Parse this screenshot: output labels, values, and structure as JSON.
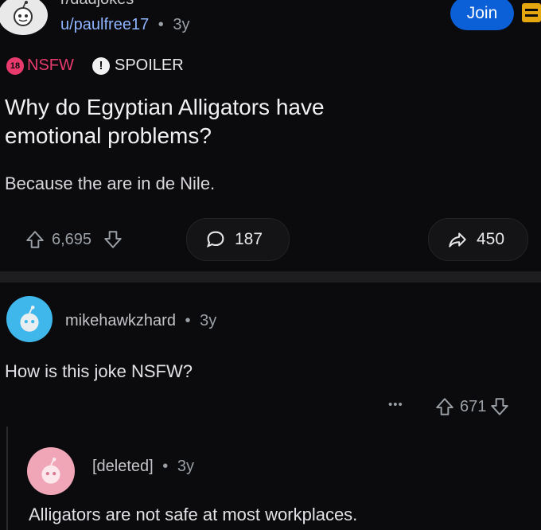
{
  "post": {
    "subreddit": "r/dadjokes",
    "author": "u/paulfree17",
    "separator": "•",
    "age": "3y",
    "join_label": "Join",
    "nsfw_badge_number": "18",
    "nsfw_label": "NSFW",
    "spoiler_mark": "!",
    "spoiler_label": "SPOILER",
    "title": "Why do Egyptian Alligators have emotional problems?",
    "body": "Because the are in de Nile.",
    "vote_count": "6,695",
    "comment_count": "187",
    "share_count": "450"
  },
  "comments": [
    {
      "author": "mikehawkzhard",
      "separator": "•",
      "age": "3y",
      "text": "How is this joke NSFW?",
      "more_label": "•••",
      "vote_count": "671",
      "avatar_color": "#3fb7ea"
    },
    {
      "author": "[deleted]",
      "separator": "•",
      "age": "3y",
      "text": "Alligators are not safe at most workplaces.",
      "avatar_color": "#f0a6b7"
    }
  ],
  "colors": {
    "accent_blue": "#0b5fd7",
    "nsfw_pink": "#e83a6d",
    "bookmark_yellow": "#e4a70f"
  }
}
